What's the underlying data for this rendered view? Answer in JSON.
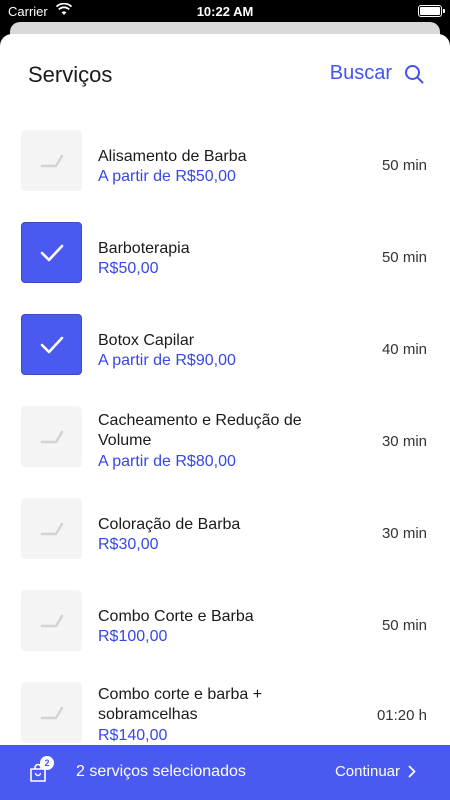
{
  "status_bar": {
    "carrier": "Carrier",
    "time": "10:22 AM"
  },
  "header": {
    "title": "Serviços",
    "search_label": "Buscar"
  },
  "services": [
    {
      "name": "Alisamento de Barba",
      "price": "A partir de R$50,00",
      "duration": "50 min",
      "checked": false
    },
    {
      "name": "Barboterapia",
      "price": "R$50,00",
      "duration": "50 min",
      "checked": true
    },
    {
      "name": "Botox Capilar",
      "price": "A partir de R$90,00",
      "duration": "40 min",
      "checked": true
    },
    {
      "name": "Cacheamento e Redução de Volume",
      "price": "A partir de R$80,00",
      "duration": "30 min",
      "checked": false
    },
    {
      "name": "Coloração de Barba",
      "price": "R$30,00",
      "duration": "30 min",
      "checked": false
    },
    {
      "name": "Combo Corte e Barba",
      "price": "R$100,00",
      "duration": "50 min",
      "checked": false
    },
    {
      "name": "Combo corte e barba + sobramcelhas",
      "price": "R$140,00",
      "duration": "01:20 h",
      "checked": false
    }
  ],
  "footer": {
    "badge_count": "2",
    "selected_text": "2 serviços selecionados",
    "continue_label": "Continuar"
  },
  "colors": {
    "accent": "#4a59f0",
    "price": "#3747e6"
  }
}
